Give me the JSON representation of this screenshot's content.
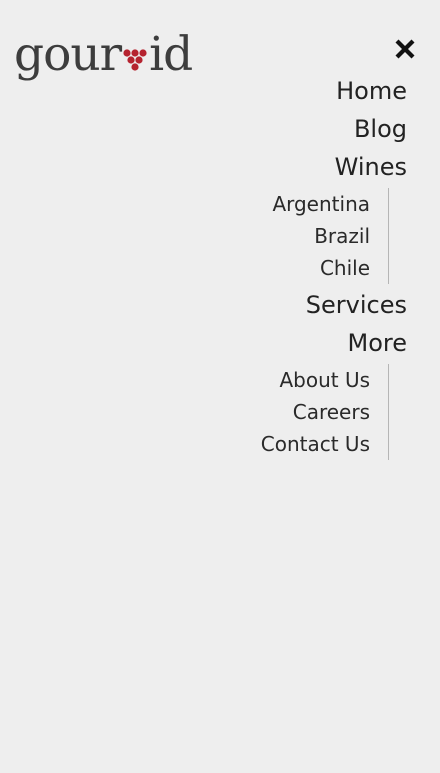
{
  "brand": {
    "name_left": "gour",
    "name_right": "id",
    "mark_color": "#b5232f"
  },
  "header": {
    "close_icon": "close-icon"
  },
  "menu": {
    "home": "Home",
    "blog": "Blog",
    "wines": "Wines",
    "wines_sub": [
      "Argentina",
      "Brazil",
      "Chile"
    ],
    "services": "Services",
    "more": "More",
    "more_sub": [
      "About Us",
      "Careers",
      "Contact Us"
    ]
  }
}
